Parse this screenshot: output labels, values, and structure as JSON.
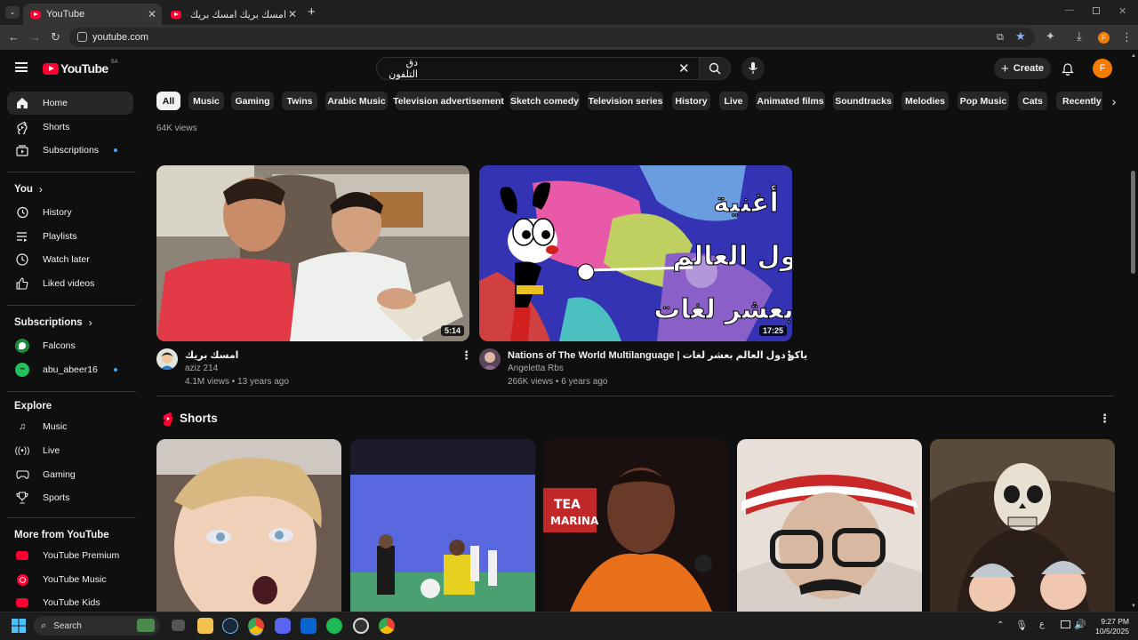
{
  "browser": {
    "tabs": [
      {
        "title": "YouTube",
        "active": true
      },
      {
        "title": "امسك بريك امسك بريك - YouTube",
        "active": false
      }
    ],
    "url": "youtube.com"
  },
  "header": {
    "logo_text": "YouTube",
    "region": "SA",
    "search_value": "دق التلفون",
    "create_label": "Create",
    "avatar_letter": "F"
  },
  "chips": [
    "All",
    "Music",
    "Gaming",
    "Twins",
    "Arabic Music",
    "Television advertisement",
    "Sketch comedy",
    "Television series",
    "History",
    "Live",
    "Animated films",
    "Soundtracks",
    "Melodies",
    "Pop Music",
    "Cats",
    "Recently up"
  ],
  "sidebar": {
    "main": [
      {
        "label": "Home",
        "icon": "home-icon"
      },
      {
        "label": "Shorts",
        "icon": "shorts-icon"
      },
      {
        "label": "Subscriptions",
        "icon": "subscriptions-icon"
      }
    ],
    "you_heading": "You",
    "you_items": [
      {
        "label": "History",
        "icon": "history-icon"
      },
      {
        "label": "Playlists",
        "icon": "playlists-icon"
      },
      {
        "label": "Watch later",
        "icon": "clock-icon"
      },
      {
        "label": "Liked videos",
        "icon": "thumbs-up-icon"
      }
    ],
    "subs_heading": "Subscriptions",
    "subs_items": [
      {
        "label": "Falcons"
      },
      {
        "label": "abu_abeer16"
      }
    ],
    "explore_heading": "Explore",
    "explore_items": [
      {
        "label": "Music",
        "icon": "music-icon"
      },
      {
        "label": "Live",
        "icon": "live-icon"
      },
      {
        "label": "Gaming",
        "icon": "gaming-icon"
      },
      {
        "label": "Sports",
        "icon": "trophy-icon"
      }
    ],
    "more_heading": "More from YouTube",
    "more_items": [
      {
        "label": "YouTube Premium"
      },
      {
        "label": "YouTube Music"
      },
      {
        "label": "YouTube Kids"
      }
    ]
  },
  "prev_row_views": "64K views",
  "videos": [
    {
      "title": "امسك بريك",
      "channel": "aziz 214",
      "meta": "4.1M views • 13 years ago",
      "duration": "5:14"
    },
    {
      "title": "Nations of The World Multilanguage | ياكو دول العالم بعشر لغات",
      "channel": "Angeletta Rbs",
      "meta": "266K views • 6 years ago",
      "duration": "17:25"
    }
  ],
  "thumb_text": {
    "line1": "أغنية",
    "line2": "دول العالم",
    "line3": "بعشر لغات"
  },
  "shorts_heading": "Shorts",
  "shorts_text": {
    "tea": "TEA",
    "marina": "MARINA"
  },
  "taskbar": {
    "search_label": "Search",
    "time": "9:27 PM",
    "date": "10/5/2025",
    "lang": "ع"
  }
}
